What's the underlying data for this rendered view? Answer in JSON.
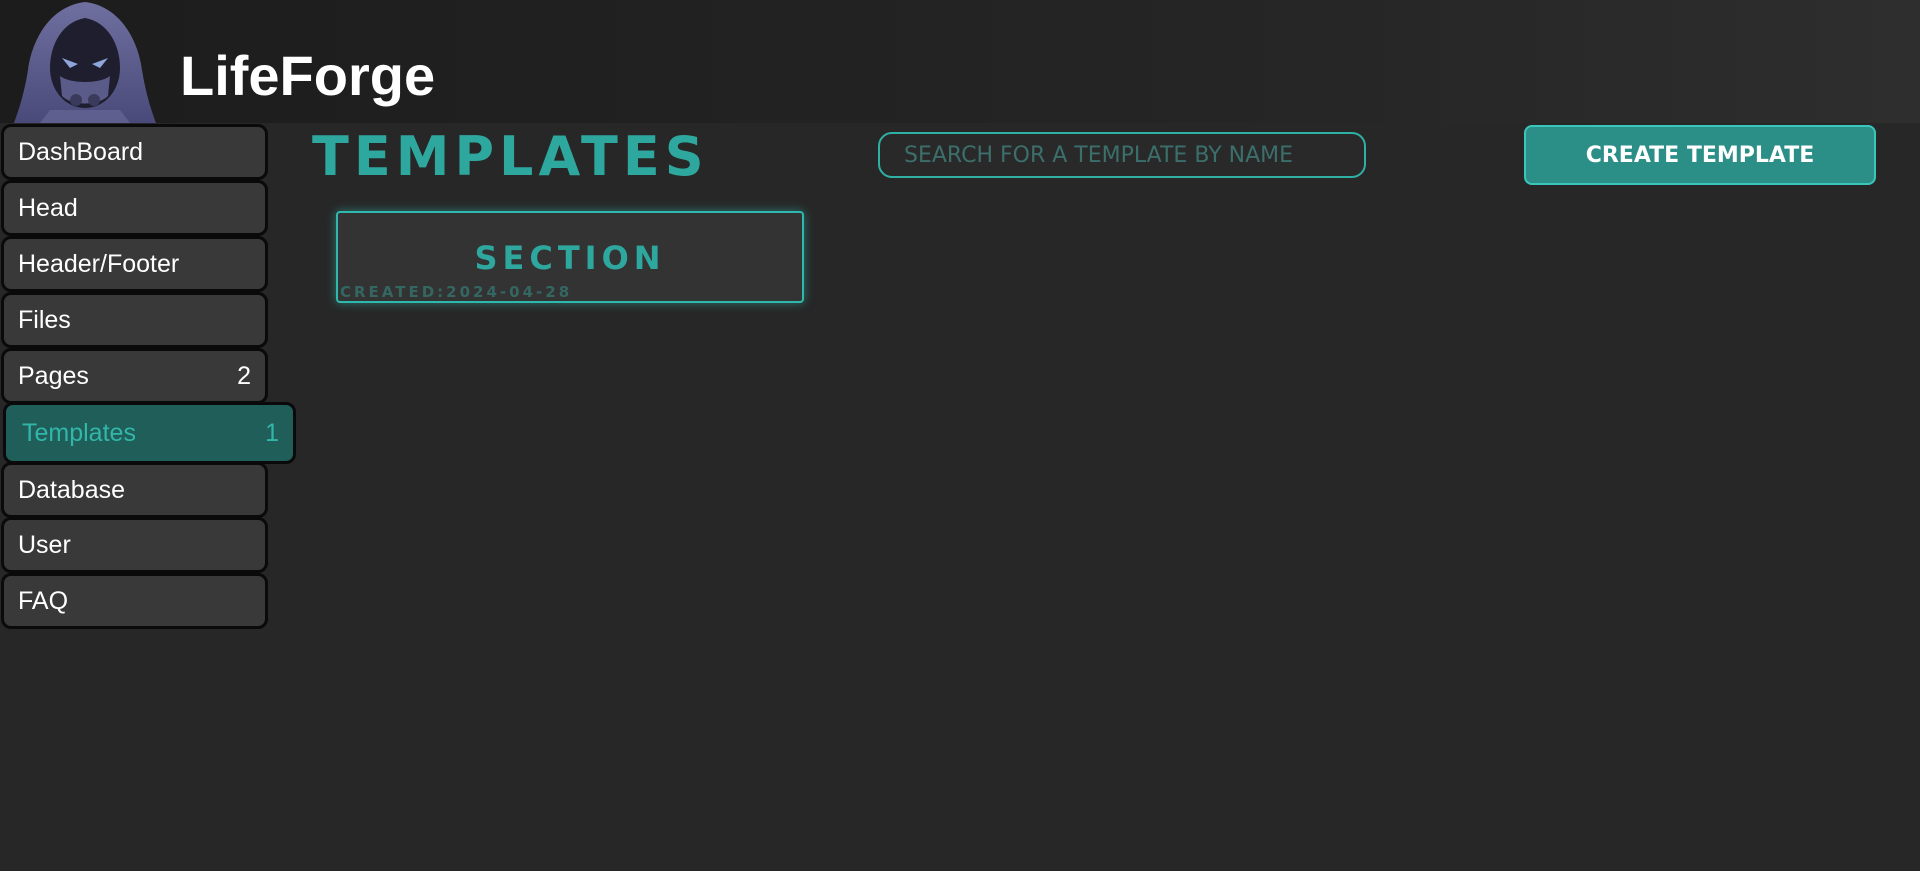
{
  "app": {
    "brand": "LifeForge",
    "logo_icon": "hooded-figure-logo-icon"
  },
  "sidebar": {
    "items": [
      {
        "label": "DashBoard",
        "count": ""
      },
      {
        "label": "Head",
        "count": ""
      },
      {
        "label": "Header/Footer",
        "count": ""
      },
      {
        "label": "Files",
        "count": ""
      },
      {
        "label": "Pages",
        "count": "2"
      },
      {
        "label": "Templates",
        "count": "1",
        "active": true
      },
      {
        "label": "Database",
        "count": ""
      },
      {
        "label": "User",
        "count": ""
      },
      {
        "label": "FAQ",
        "count": ""
      }
    ]
  },
  "main": {
    "title": "TEMPLATES",
    "search": {
      "placeholder": "SEARCH FOR A TEMPLATE BY NAME",
      "value": ""
    },
    "create_label": "CREATE TEMPLATE",
    "templates": [
      {
        "name": "SECTION",
        "created": "CREATED:2024-04-28"
      }
    ]
  },
  "colors": {
    "accent": "#2ea79e",
    "active_bg": "#1f5e59",
    "background": "#272727",
    "nav_bg": "#393939"
  }
}
